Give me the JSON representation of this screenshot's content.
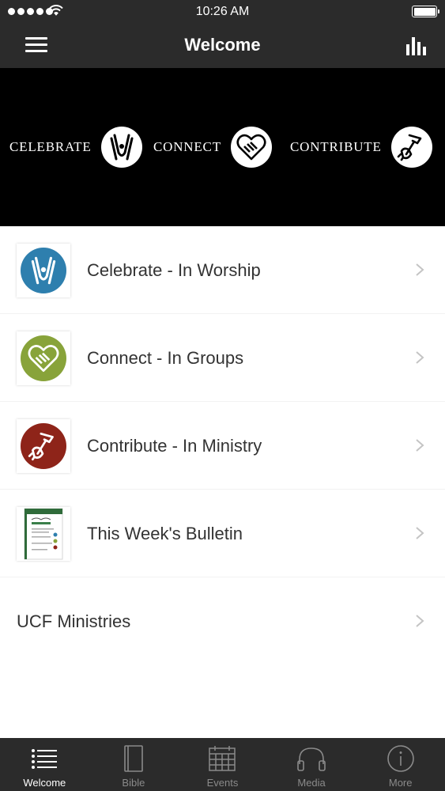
{
  "status_bar": {
    "time": "10:26 AM",
    "signal_icon": "signal-dots-icon",
    "wifi_icon": "wifi-icon",
    "battery_icon": "battery-icon",
    "battery_level": 1.0
  },
  "nav": {
    "title": "Welcome",
    "menu_icon": "hamburger-menu-icon",
    "stats_icon": "bar-chart-icon"
  },
  "banner": {
    "items": [
      {
        "label": "CELEBRATE",
        "icon": "raised-hands-icon"
      },
      {
        "label": "CONNECT",
        "icon": "handshake-heart-icon"
      },
      {
        "label": "CONTRIBUTE",
        "icon": "hammer-hand-icon"
      }
    ]
  },
  "list": {
    "items": [
      {
        "label": "Celebrate - In Worship",
        "icon": "raised-hands-icon",
        "color": "#2e7fae"
      },
      {
        "label": "Connect - In Groups",
        "icon": "handshake-heart-icon",
        "color": "#88a33a"
      },
      {
        "label": "Contribute - In Ministry",
        "icon": "hammer-hand-icon",
        "color": "#8e2419"
      },
      {
        "label": "This Week's Bulletin",
        "icon": "bulletin-document-icon"
      },
      {
        "label": "UCF Ministries"
      }
    ]
  },
  "tab_bar": {
    "tabs": [
      {
        "label": "Welcome",
        "icon": "list-icon",
        "active": true
      },
      {
        "label": "Bible",
        "icon": "book-icon",
        "active": false
      },
      {
        "label": "Events",
        "icon": "calendar-icon",
        "active": false
      },
      {
        "label": "Media",
        "icon": "headphones-icon",
        "active": false
      },
      {
        "label": "More",
        "icon": "info-icon",
        "active": false
      }
    ]
  },
  "colors": {
    "bar_background": "#2b2b2b",
    "banner_background": "#000000",
    "celebrate": "#2e7fae",
    "connect": "#88a33a",
    "contribute": "#8e2419"
  }
}
